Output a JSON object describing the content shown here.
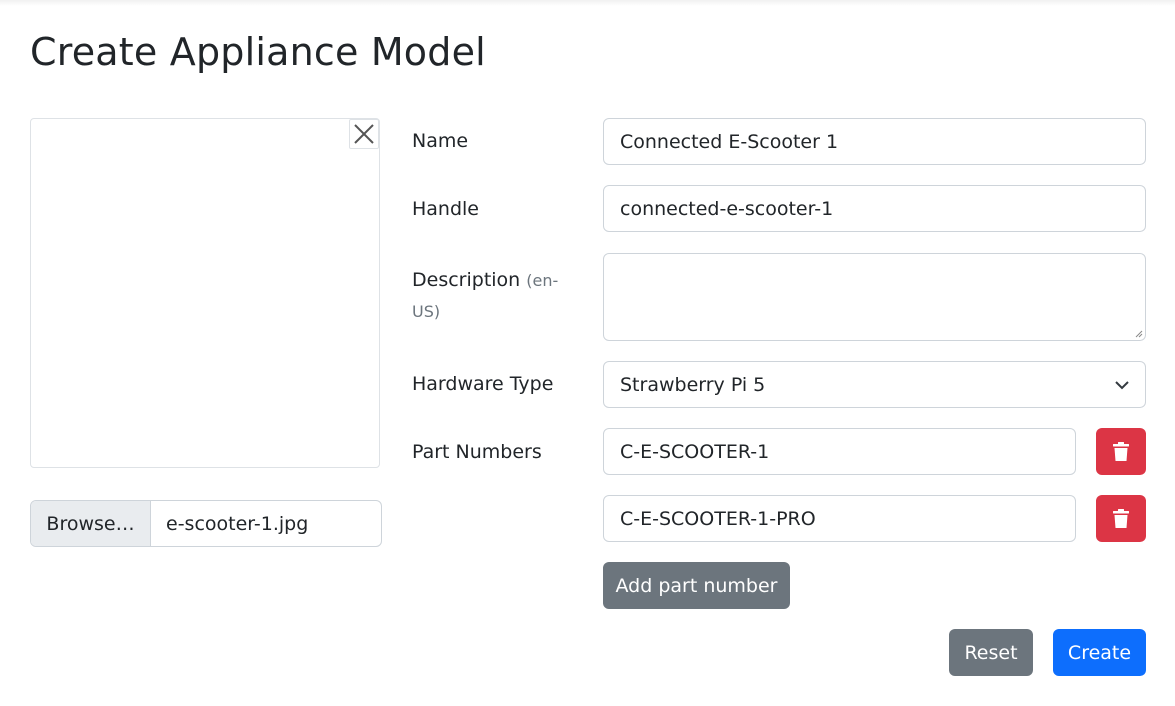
{
  "page": {
    "title": "Create Appliance Model"
  },
  "image_panel": {
    "close_icon": "close-icon",
    "browse_label": "Browse…",
    "file_name": "e-scooter-1.jpg"
  },
  "form": {
    "name": {
      "label": "Name",
      "value": "Connected E-Scooter 1"
    },
    "handle": {
      "label": "Handle",
      "value": "connected-e-scooter-1"
    },
    "description": {
      "label": "Description",
      "locale_part1": "(en-",
      "locale_part2": "US)",
      "value": ""
    },
    "hardware_type": {
      "label": "Hardware Type",
      "value": "Strawberry Pi 5"
    },
    "part_numbers": {
      "label": "Part Numbers",
      "items": [
        {
          "value": "C-E-SCOOTER-1"
        },
        {
          "value": "C-E-SCOOTER-1-PRO"
        }
      ],
      "add_label": "Add part number"
    }
  },
  "actions": {
    "reset_label": "Reset",
    "create_label": "Create"
  },
  "colors": {
    "primary": "#0d6efd",
    "secondary": "#6c757d",
    "danger": "#dc3545"
  }
}
